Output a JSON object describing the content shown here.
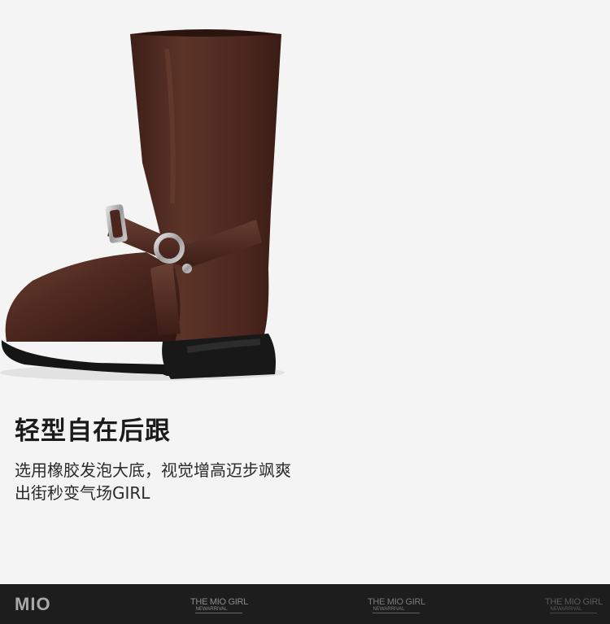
{
  "product": {
    "headline": "轻型自在后跟",
    "description_line1": "选用橡胶发泡大底，视觉增高迈步飒爽",
    "description_line2": "出街秒变气场GIRL"
  },
  "footer": {
    "logo": "MIO",
    "watermark_title": "THE MIO GIRL",
    "watermark_sub": "NEWARRIVAL"
  },
  "colors": {
    "leather": "#4e2a22",
    "sole": "#141414",
    "footer_bg": "#1d1d1d"
  }
}
